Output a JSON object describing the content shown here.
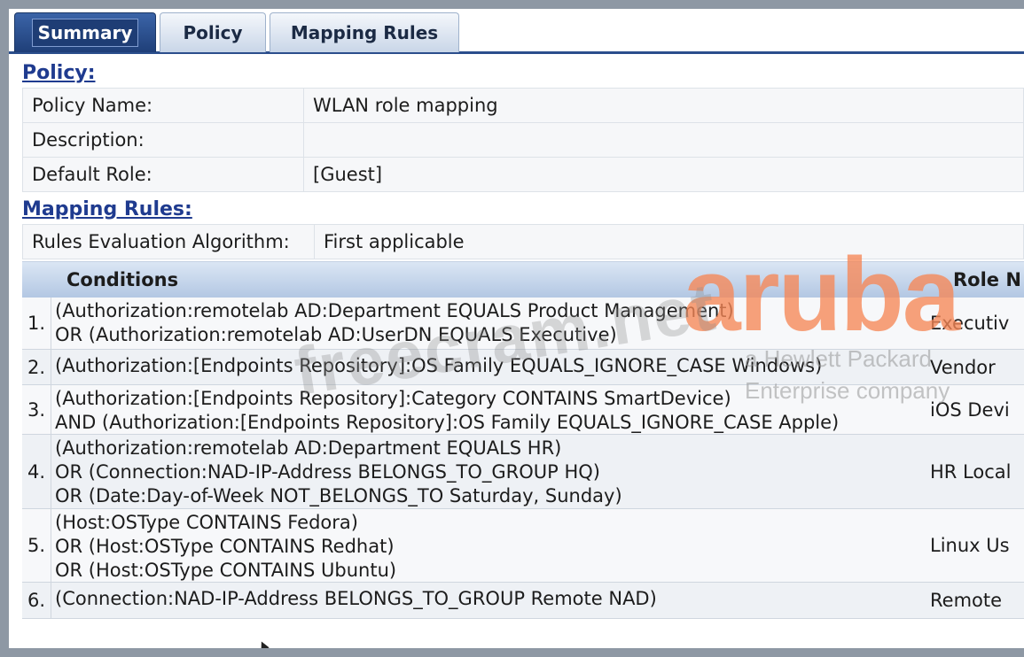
{
  "tabs": [
    {
      "label": "Summary",
      "active": true
    },
    {
      "label": "Policy",
      "active": false
    },
    {
      "label": "Mapping Rules",
      "active": false
    }
  ],
  "policy_section": {
    "heading": "Policy:",
    "rows": [
      {
        "label": "Policy Name:",
        "value": "WLAN role mapping"
      },
      {
        "label": "Description:",
        "value": ""
      },
      {
        "label": "Default Role:",
        "value": "[Guest]"
      }
    ]
  },
  "mapping_section": {
    "heading": "Mapping Rules:",
    "algorithm_label": "Rules Evaluation Algorithm:",
    "algorithm_value": "First applicable"
  },
  "rules_table": {
    "headers": {
      "conditions": "Conditions",
      "role": "Role N"
    },
    "rows": [
      {
        "num": "1.",
        "lines": [
          "(Authorization:remotelab AD:Department EQUALS Product Management)",
          "OR (Authorization:remotelab AD:UserDN EQUALS Executive)"
        ],
        "role": "Executiv"
      },
      {
        "num": "2.",
        "lines": [
          "(Authorization:[Endpoints Repository]:OS Family EQUALS_IGNORE_CASE Windows)"
        ],
        "role": "Vendor"
      },
      {
        "num": "3.",
        "lines": [
          "(Authorization:[Endpoints Repository]:Category CONTAINS SmartDevice)",
          "AND (Authorization:[Endpoints Repository]:OS Family EQUALS_IGNORE_CASE Apple)"
        ],
        "role": "iOS Devi"
      },
      {
        "num": "4.",
        "lines": [
          "(Authorization:remotelab AD:Department EQUALS HR)",
          "OR (Connection:NAD-IP-Address BELONGS_TO_GROUP HQ)",
          "OR (Date:Day-of-Week NOT_BELONGS_TO Saturday, Sunday)"
        ],
        "role": "HR Local"
      },
      {
        "num": "5.",
        "lines": [
          "(Host:OSType CONTAINS Fedora)",
          "OR (Host:OSType CONTAINS Redhat)",
          "OR (Host:OSType CONTAINS Ubuntu)"
        ],
        "role": "Linux Us"
      },
      {
        "num": "6.",
        "lines": [
          "(Connection:NAD-IP-Address BELONGS_TO_GROUP Remote NAD)"
        ],
        "role": "Remote"
      }
    ]
  },
  "watermarks": {
    "site": "freecram.net",
    "brand": "aruba",
    "brand_tagline_1": "a Hewlett Packard",
    "brand_tagline_2": "Enterprise company",
    "brand_color": "#f68656"
  }
}
